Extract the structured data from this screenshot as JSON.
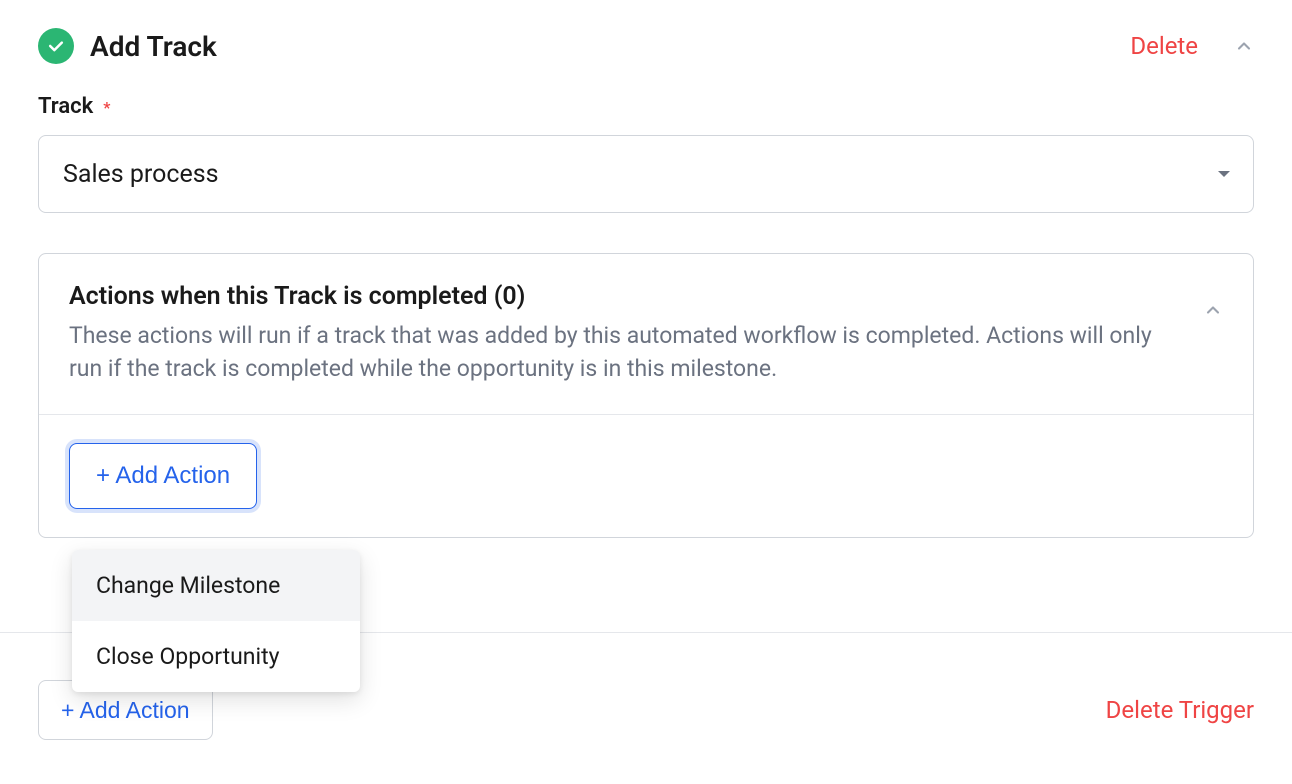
{
  "header": {
    "title": "Add Track",
    "delete_label": "Delete"
  },
  "form": {
    "track_label": "Track",
    "track_required": "*",
    "track_value": "Sales process"
  },
  "panel": {
    "title": "Actions when this Track is completed (0)",
    "description": "These actions will run if a track that was added by this automated workflow is completed. Actions will only run if the track is completed while the opportunity is in this milestone.",
    "add_action_label": "+ Add Action"
  },
  "dropdown": {
    "items": [
      {
        "label": "Change Milestone"
      },
      {
        "label": "Close Opportunity"
      }
    ]
  },
  "bottom": {
    "add_action_label": "+ Add Action",
    "delete_trigger_label": "Delete Trigger"
  },
  "colors": {
    "accent": "#2563eb",
    "success": "#2bb673",
    "danger": "#ef4444"
  }
}
